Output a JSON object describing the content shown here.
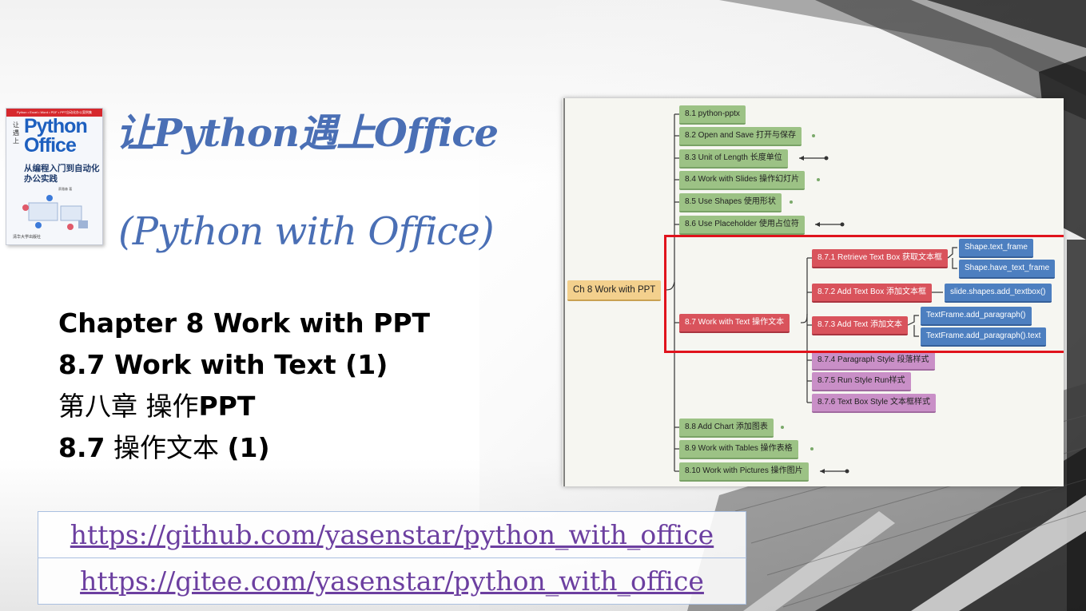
{
  "book": {
    "band_text": "Python • Excel • Word • PDF • PPT自动化办公案例集",
    "side_text": "让遇上",
    "cover_title": "Python Office",
    "cover_subtitle": "从编程入门到自动化办公实践",
    "author": "蔡雅森 著",
    "publisher": "清华大学出版社"
  },
  "title": {
    "line1": "让Python遇上Office",
    "line2": "(Python with Office)"
  },
  "subtitle": {
    "line1": "Chapter 8 Work with PPT",
    "line2": "8.7 Work with Text (1)",
    "line3_a": "第八章 操作",
    "line3_b": "PPT",
    "line4_a": "8.7",
    "line4_b": " 操作文本 ",
    "line4_c": "(1)"
  },
  "links": {
    "github": "https://github.com/yasenstar/python_with_office",
    "gitee": "https://gitee.com/yasenstar/python_with_office"
  },
  "mindmap": {
    "root": "Ch 8 Work with PPT",
    "sections": [
      "8.1 python-pptx",
      "8.2 Open and Save 打开与保存",
      "8.3 Unit of Length 长度单位",
      "8.4 Work with Slides 操作幻灯片",
      "8.5 Use Shapes 使用形状",
      "8.6 Use Placeholder 使用占位符",
      "8.7 Work with Text 操作文本",
      "8.8 Add Chart 添加图表",
      "8.9 Work with Tables 操作表格",
      "8.10 Work with Pictures 操作图片"
    ],
    "subsections": [
      "8.7.1 Retrieve Text Box 获取文本框",
      "8.7.2 Add Text Box 添加文本框",
      "8.7.3 Add Text 添加文本",
      "8.7.4 Paragraph Style 段落样式",
      "8.7.5 Run Style Run样式",
      "8.7.6 Text Box Style 文本框样式"
    ],
    "leaves": [
      "Shape.text_frame",
      "Shape.have_text_frame",
      "slide.shapes.add_textbox()",
      "TextFrame.add_paragraph()",
      "TextFrame.add_paragraph().text"
    ],
    "colors": {
      "root": "#f3d08d",
      "section": "#9cc285",
      "highlight": "#d9535c",
      "leaf": "#4d7fc0",
      "other_sub": "#c98fc7",
      "red_box": "#e0131c"
    }
  },
  "colors": {
    "title": "#4a6fb5",
    "link": "#6c3fa0"
  }
}
